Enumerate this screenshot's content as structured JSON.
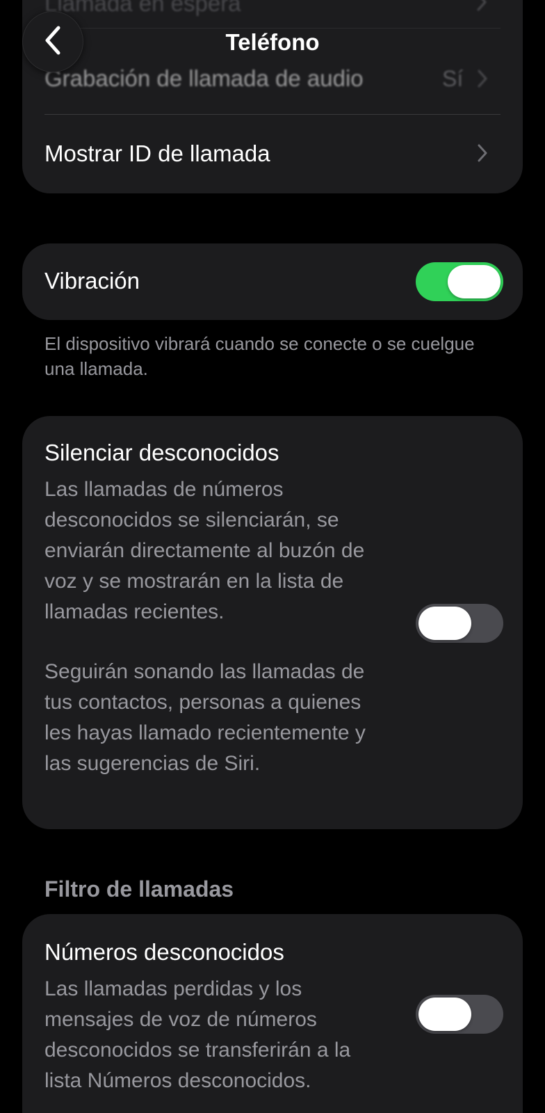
{
  "header": {
    "title": "Teléfono",
    "back_icon": "chevron-left-icon"
  },
  "top_group": {
    "clipped_item": {
      "label": "Llamada en espera"
    },
    "recording": {
      "label": "Grabación de llamada de audio",
      "value": "Sí"
    },
    "caller_id": {
      "label": "Mostrar ID de llamada"
    }
  },
  "vibration": {
    "label": "Vibración",
    "enabled": true,
    "footnote": "El dispositivo vibrará cuando se conecte o se cuelgue una llamada."
  },
  "silence_unknown": {
    "title": "Silenciar desconocidos",
    "description1": "Las llamadas de números desconocidos se silenciarán, se enviarán directamente al buzón de voz y se mostrarán en la lista de llamadas recientes.",
    "description2": "Seguirán sonando las llamadas de tus contactos, personas a quienes les hayas llamado recientemente y las sugerencias de Siri.",
    "enabled": false
  },
  "call_filter": {
    "section_title": "Filtro de llamadas",
    "unknown_numbers": {
      "title": "Números desconocidos",
      "description": "Las llamadas perdidas y los mensajes de voz de números desconocidos se transferirán a la lista Números desconocidos.",
      "enabled": false
    }
  },
  "colors": {
    "background": "#000000",
    "card": "#1c1c1e",
    "toggle_on": "#30d158",
    "toggle_off": "#4a4a4f",
    "secondary_text": "#98989e"
  }
}
